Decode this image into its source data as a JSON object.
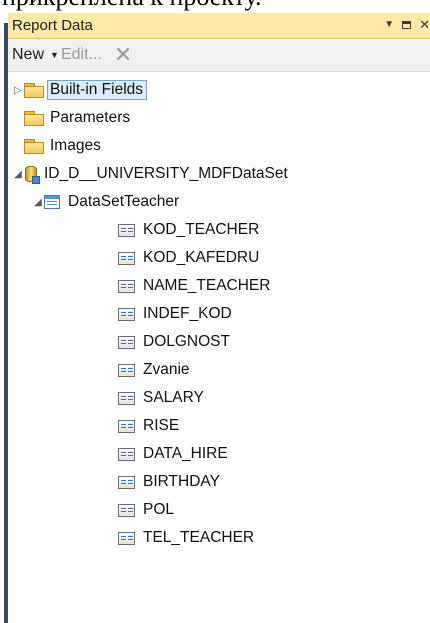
{
  "document": {
    "overlay_text": "прикреплена к проекту."
  },
  "panel": {
    "title": "Report Data",
    "controls": {
      "menu": "▼",
      "close": "✕"
    }
  },
  "toolbar": {
    "new_label": "New",
    "new_caret": "▼",
    "edit_label": "Edit...",
    "delete_glyph": "✕"
  },
  "tree": {
    "builtin_fields": {
      "label": "Built-in Fields",
      "expander": "▷",
      "selected": true
    },
    "parameters": {
      "label": "Parameters"
    },
    "images": {
      "label": "Images"
    },
    "dataset_source": {
      "label": "ID_D__UNIVERSITY_MDFDataSet",
      "expander": "◢"
    },
    "dataset": {
      "label": "DataSetTeacher",
      "expander": "◢"
    },
    "fields": [
      "KOD_TEACHER",
      "KOD_KAFEDRU",
      "NAME_TEACHER",
      "INDEF_KOD",
      "DOLGNOST",
      "Zvanie",
      "SALARY",
      "RISE",
      "DATA_HIRE",
      "BIRTHDAY",
      "POL",
      "TEL_TEACHER"
    ]
  },
  "colors": {
    "title_bar": "#ffe9a6",
    "toolbar": "#f0f0f0",
    "selection": "#dcebfc",
    "left_border": "#3a4a5c"
  }
}
